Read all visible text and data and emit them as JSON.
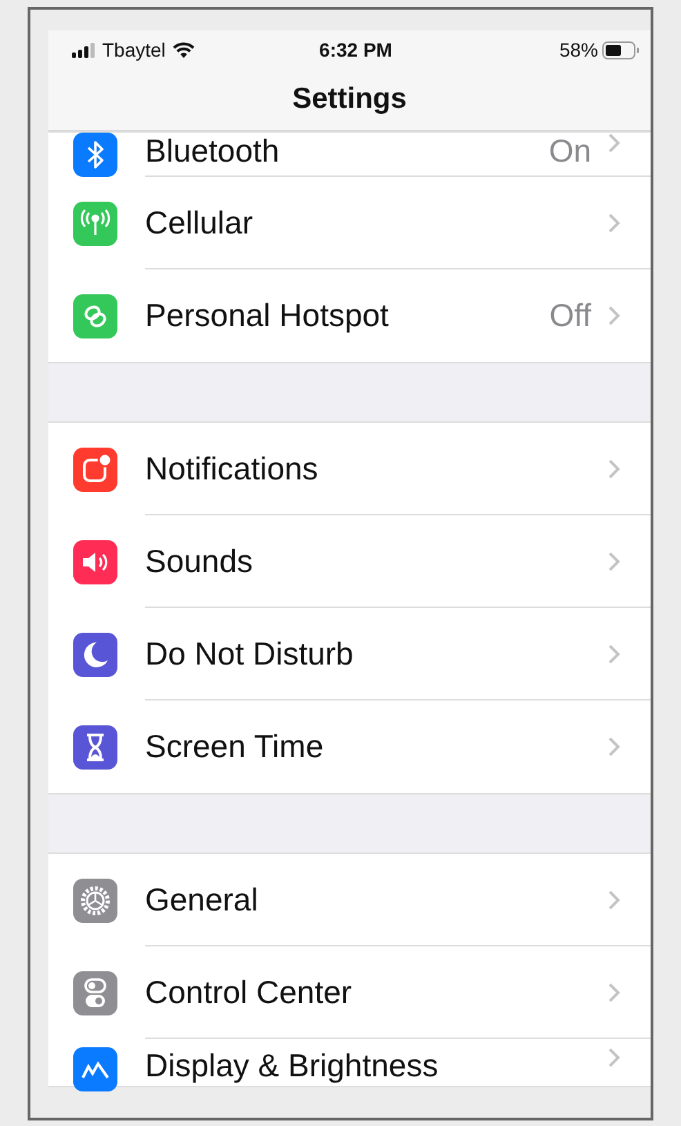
{
  "status_bar": {
    "carrier": "Tbaytel",
    "time": "6:32 PM",
    "battery": "58%"
  },
  "title": "Settings",
  "groups": [
    {
      "rows": [
        {
          "label": "Bluetooth",
          "value": "On",
          "color": "#0a7aff"
        },
        {
          "label": "Cellular",
          "color": "#34c759"
        },
        {
          "label": "Personal Hotspot",
          "value": "Off",
          "color": "#34c759"
        }
      ]
    },
    {
      "rows": [
        {
          "label": "Notifications",
          "color": "#ff3b30"
        },
        {
          "label": "Sounds",
          "color": "#ff2d55"
        },
        {
          "label": "Do Not Disturb",
          "color": "#5856d6"
        },
        {
          "label": "Screen Time",
          "color": "#5856d6"
        }
      ]
    },
    {
      "rows": [
        {
          "label": "General",
          "color": "#8e8e93"
        },
        {
          "label": "Control Center",
          "color": "#8e8e93"
        },
        {
          "label": "Display & Brightness",
          "color": "#0a7aff"
        }
      ]
    }
  ]
}
